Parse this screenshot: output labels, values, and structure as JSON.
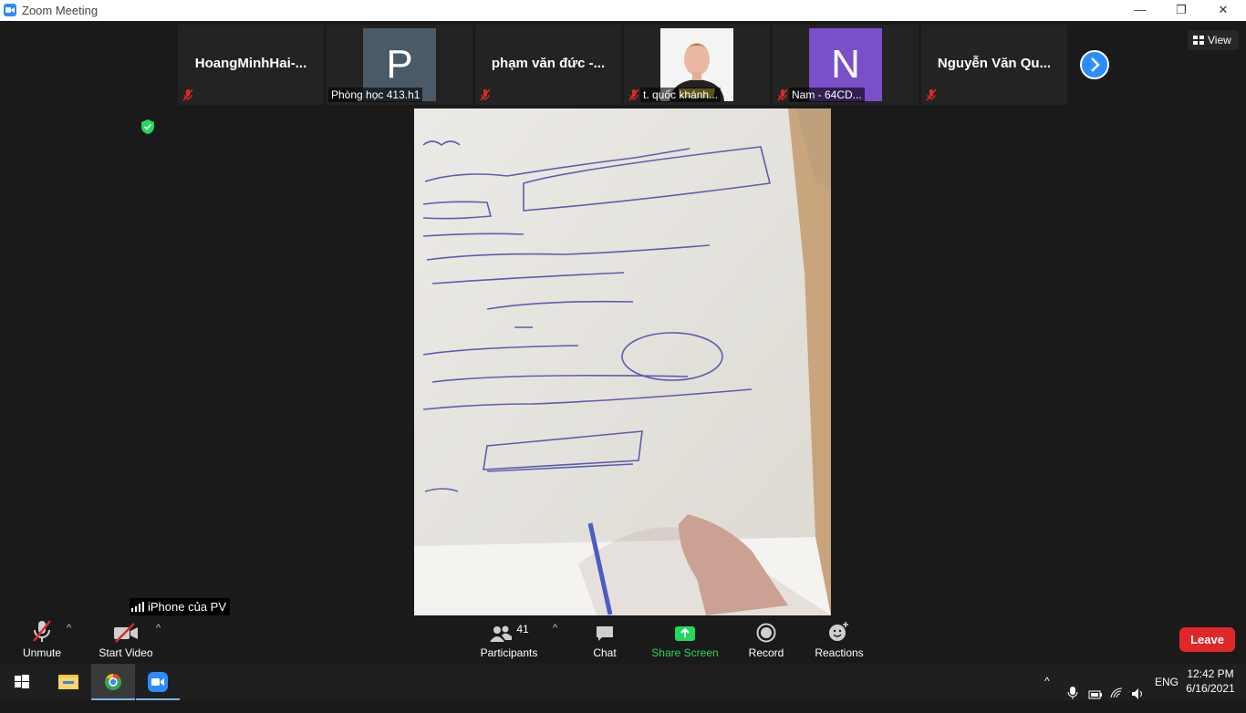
{
  "window": {
    "title": "Zoom Meeting",
    "minimize": "—",
    "maximize": "❐",
    "close": "✕"
  },
  "participants_strip": [
    {
      "name": "HoangMinhHai-...",
      "label": "",
      "avatar_letter": "",
      "avatar_color": ""
    },
    {
      "name": "",
      "label": "Phòng học 413.h1",
      "avatar_letter": "P",
      "avatar_color": "#4a5a66"
    },
    {
      "name": "phạm văn đức -...",
      "label": "",
      "avatar_letter": "",
      "avatar_color": ""
    },
    {
      "name": "",
      "label": "t. quốc khánh...",
      "avatar_letter": "",
      "avatar_color": ""
    },
    {
      "name": "",
      "label": "Nam - 64CD...",
      "avatar_letter": "N",
      "avatar_color": "#7b4fc9"
    },
    {
      "name": "Nguyễn Văn Qu...",
      "label": "",
      "avatar_letter": "",
      "avatar_color": ""
    }
  ],
  "view_button": "View",
  "share_source": "iPhone của PV",
  "toolbar": {
    "unmute": "Unmute",
    "start_video": "Start Video",
    "participants": "Participants",
    "participants_count": "41",
    "chat": "Chat",
    "share_screen": "Share Screen",
    "record": "Record",
    "reactions": "Reactions",
    "leave": "Leave"
  },
  "taskbar": {
    "language": "ENG",
    "time": "12:42 PM",
    "date": "6/16/2021"
  },
  "colors": {
    "zoom_blue": "#2d8cff",
    "share_green": "#23d959",
    "leave_red": "#e02828",
    "mute_red": "#e02828"
  }
}
